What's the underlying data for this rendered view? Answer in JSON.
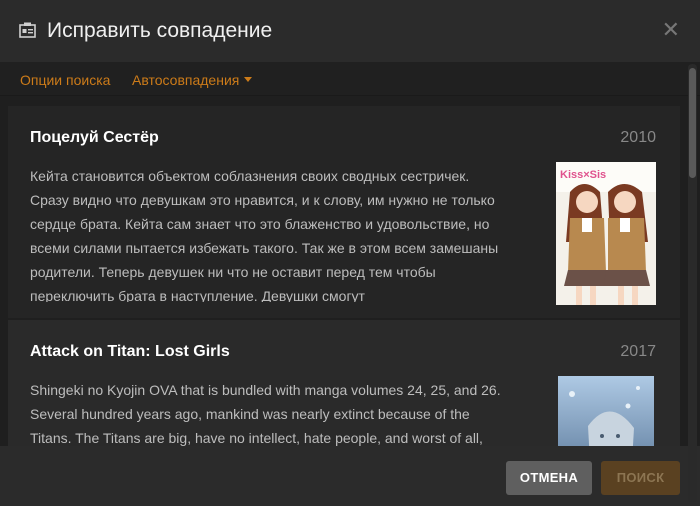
{
  "dialog": {
    "title": "Исправить совпадение",
    "close_symbol": "✕"
  },
  "subnav": {
    "search_options": "Опции поиска",
    "auto_matches": "Автосовпадения"
  },
  "results": [
    {
      "title": "Поцелуй Сестёр",
      "year": "2010",
      "description": "Кейта становится объектом соблазнения своих сводных сестричек. Сразу видно что девушкам это нравится, и к слову, им нужно не только сердце брата. Кейта сам знает что это блаженство и удовольствие, но всеми силами пытается избежать такого. Так же в этом всем замешаны родители. Теперь девушек ни что не оставит перед тем чтобы переключить брата в наступление. Девушки смогут",
      "poster_text": "Kiss×Sis"
    },
    {
      "title": "Attack on Titan: Lost Girls",
      "year": "2017",
      "description": "Shingeki no Kyojin OVA that is bundled with manga volumes 24, 25, and 26. Several hundred years ago, mankind was nearly extinct because of the Titans. The Titans are big, have no intellect, hate people, and worst of all, they think of humans as food. The survivors of the humans built a very"
    }
  ],
  "footer": {
    "cancel_label": "ОТМЕНА",
    "search_label": "ПОИСК"
  },
  "colors": {
    "accent": "#cc7b19",
    "background": "#252525",
    "cancel_button": "#5f5f5f",
    "search_button_disabled": "#5a4121"
  }
}
